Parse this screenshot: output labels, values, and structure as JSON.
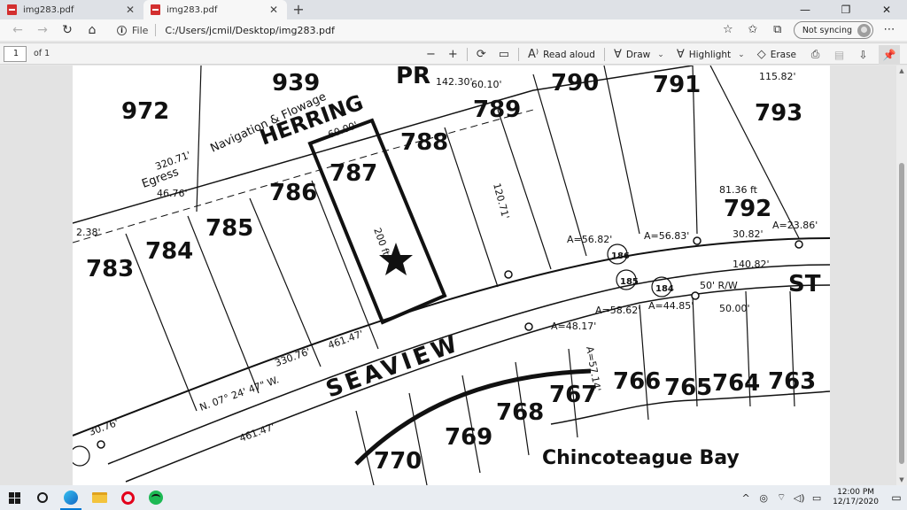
{
  "browser": {
    "tabs": [
      {
        "title": "img283.pdf",
        "active": false
      },
      {
        "title": "img283.pdf",
        "active": true
      }
    ],
    "new_tab": "+",
    "window_controls": {
      "minimize": "—",
      "maximize": "❐",
      "close": "✕"
    }
  },
  "address_bar": {
    "back": "←",
    "forward": "→",
    "refresh": "↻",
    "home": "⌂",
    "scheme_label": "File",
    "url": "C:/Users/jcmil/Desktop/img283.pdf",
    "favorite_icon": "☆",
    "favorites_icon": "✩",
    "collections_icon": "⧉",
    "sync_label": "Not syncing",
    "menu_icon": "⋯"
  },
  "pdf_toolbar": {
    "page_number": "1",
    "page_total": "of 1",
    "zoom_out": "−",
    "zoom_in": "+",
    "rotate": "⟳",
    "fit": "▭",
    "read_aloud": {
      "icon": "A⁾",
      "label": "Read aloud"
    },
    "draw": {
      "icon": "∀",
      "label": "Draw",
      "chev": "⌄"
    },
    "highlight": {
      "icon": "∀",
      "label": "Highlight",
      "chev": "⌄"
    },
    "erase": {
      "icon": "◇",
      "label": "Erase"
    },
    "print_icon": "⎙",
    "save_icon": "▤",
    "save_as_icon": "⇩",
    "pin_icon": "📌"
  },
  "map": {
    "lots": [
      "972",
      "939",
      "PR",
      "790",
      "791",
      "793",
      "789",
      "788",
      "787",
      "786",
      "785",
      "784",
      "783",
      "792",
      "186",
      "185",
      "184",
      "770",
      "769",
      "768",
      "767",
      "766",
      "765",
      "764",
      "763"
    ],
    "street_names": [
      "HERRING",
      "SEAVIEW",
      "ST"
    ],
    "bay_name": "Chincoteague Bay",
    "easement": [
      "Navigation & Flowage",
      "Egress"
    ],
    "dims": [
      "60.00'",
      "200 ft",
      "142.30'",
      "60.10'",
      "115.82'",
      "A=56.82'",
      "A=56.83'",
      "A=58.62'",
      "A=44.85'",
      "50.00'",
      "140.82'",
      "50' R/W",
      "461.47'",
      "330.76'",
      "N. 07° 24' 47\" W.",
      "30.76'",
      "461.47'",
      "30.82'",
      "81.36 ft",
      "A=23.86'",
      "120.71'",
      "A=48.17'",
      "A=57.14'",
      "320.71'",
      "46.76'",
      "2.38'"
    ]
  },
  "taskbar": {
    "clock_time": "12:00 PM",
    "clock_date": "12/17/2020",
    "tray_chevron": "^",
    "notification_icon": "▭"
  },
  "scrollbar": {
    "up": "▲",
    "down": "▼"
  }
}
